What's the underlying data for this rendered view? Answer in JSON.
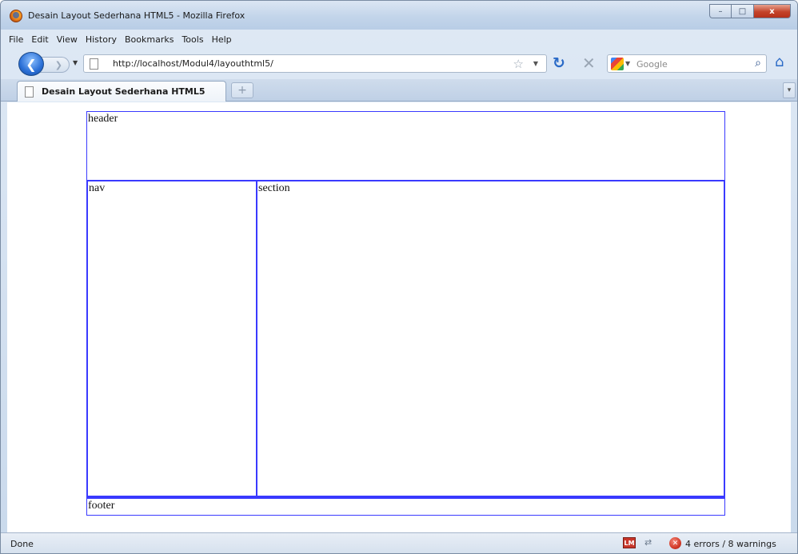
{
  "window": {
    "title": "Desain Layout Sederhana HTML5 - Mozilla Firefox",
    "controls": {
      "minimize": "–",
      "maximize": "□",
      "close": "x"
    }
  },
  "menu": [
    "File",
    "Edit",
    "View",
    "History",
    "Bookmarks",
    "Tools",
    "Help"
  ],
  "navbar": {
    "back_glyph": "❮",
    "forward_glyph": "❯",
    "url": "http://localhost/Modul4/layouthtml5/",
    "search_placeholder": "Google"
  },
  "tabs": [
    {
      "label": "Desain Layout Sederhana HTML5",
      "active": true
    }
  ],
  "page": {
    "header": "header",
    "nav": "nav",
    "section": "section",
    "footer": "footer",
    "border_color": "#3a3aff"
  },
  "status": {
    "text": "Done",
    "addon_badge": "LM",
    "errors": "4 errors / 8 warnings"
  },
  "icons": {
    "app": "firefox-icon",
    "reload": "reload-icon",
    "stop": "stop-icon",
    "home": "home-icon",
    "bookmark": "star-icon",
    "search": "magnifier-icon"
  }
}
